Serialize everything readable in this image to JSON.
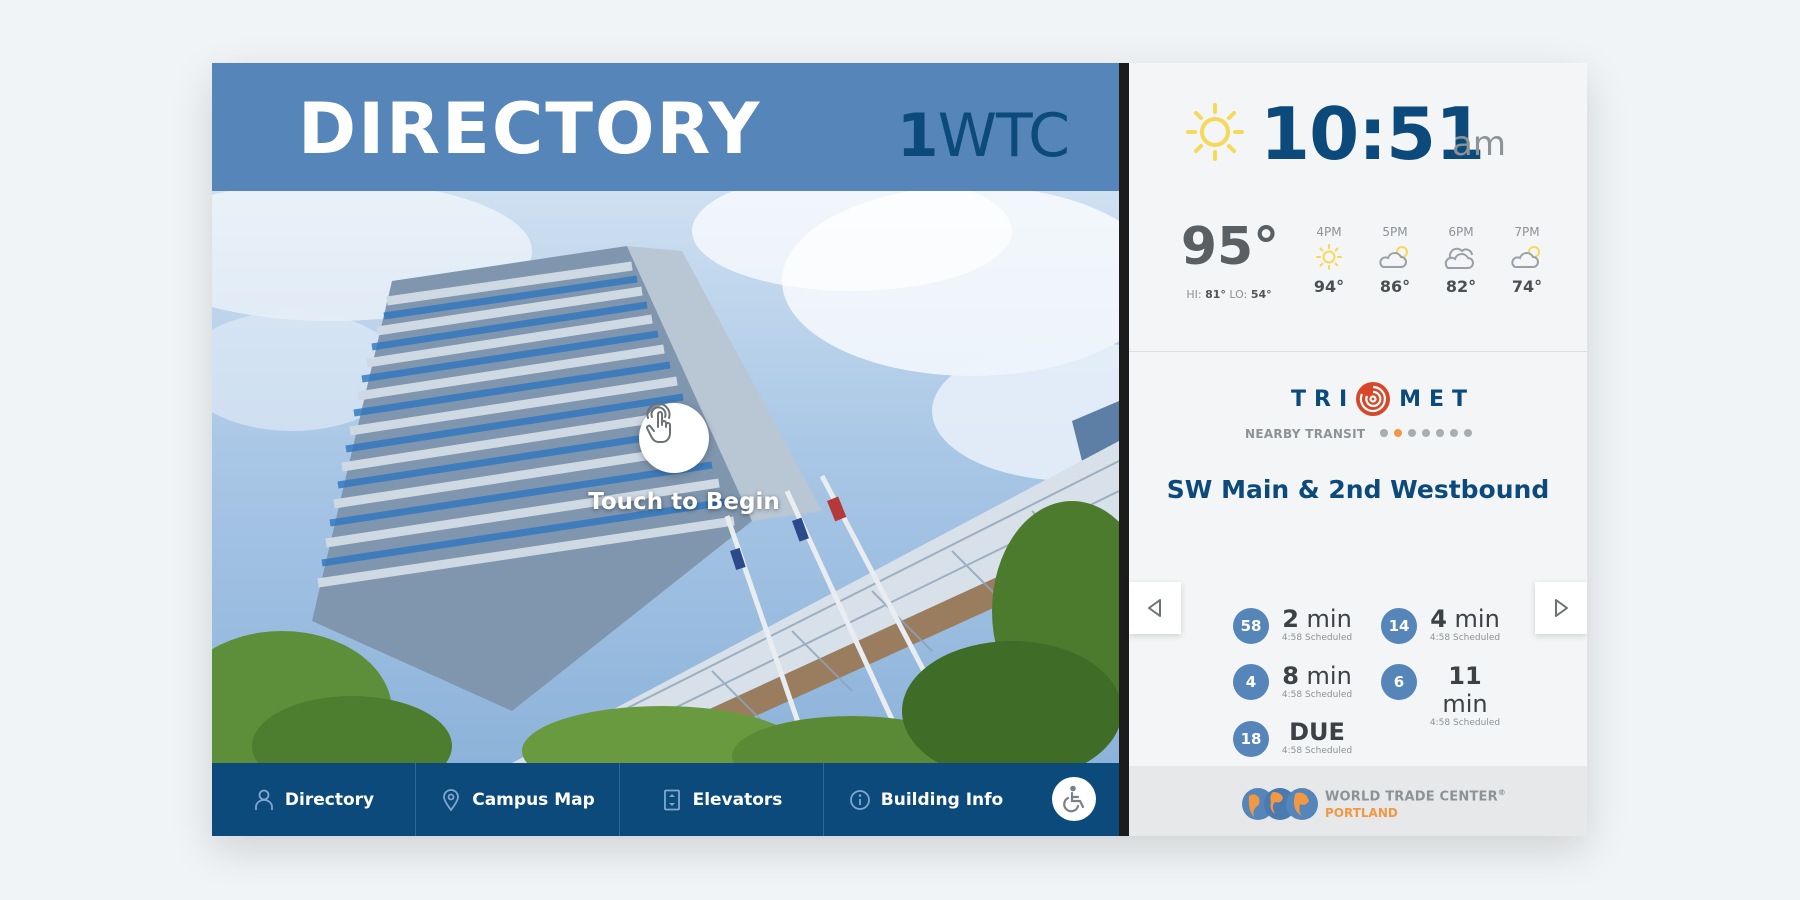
{
  "header": {
    "title": "DIRECTORY",
    "building_num": "1",
    "building_code": "WTC"
  },
  "hero": {
    "touch_label": "Touch to Begin"
  },
  "nav": {
    "items": [
      {
        "label": "Directory",
        "icon": "person-icon"
      },
      {
        "label": "Campus Map",
        "icon": "map-pin-icon"
      },
      {
        "label": "Elevators",
        "icon": "elevator-icon"
      },
      {
        "label": "Building Info",
        "icon": "info-icon"
      }
    ],
    "accessibility_icon": "wheelchair-icon"
  },
  "clock": {
    "time": "10:51",
    "ampm": "am",
    "icon": "sun-icon"
  },
  "weather": {
    "current_temp": "95°",
    "hi_label": "HI:",
    "hi": "81°",
    "lo_label": "LO:",
    "lo": "54°",
    "forecast": [
      {
        "hour": "4PM",
        "icon": "sun-icon",
        "temp": "94°"
      },
      {
        "hour": "5PM",
        "icon": "partly-cloudy-icon",
        "temp": "86°"
      },
      {
        "hour": "6PM",
        "icon": "cloud-icon",
        "temp": "82°"
      },
      {
        "hour": "7PM",
        "icon": "partly-cloudy-icon",
        "temp": "74°"
      }
    ]
  },
  "transit": {
    "brand_left": "TRI",
    "brand_right": "MET",
    "nearby_label": "NEARBY TRANSIT",
    "page_count": 7,
    "active_page": 2,
    "stop_name": "SW Main & 2nd Westbound",
    "arrivals": [
      {
        "route": "58",
        "value": "2",
        "unit": "min",
        "sched": "4:58 Scheduled"
      },
      {
        "route": "14",
        "value": "4",
        "unit": "min",
        "sched": "4:58 Scheduled"
      },
      {
        "route": "4",
        "value": "8",
        "unit": "min",
        "sched": "4:58 Scheduled"
      },
      {
        "route": "6",
        "value": "11",
        "unit": "min",
        "sched": "4:58 Scheduled"
      },
      {
        "route": "18",
        "value": "DUE",
        "unit": "",
        "sched": "4:58 Scheduled"
      }
    ]
  },
  "footer": {
    "name": "WORLD TRADE CENTER",
    "reg": "®",
    "city": "PORTLAND"
  },
  "colors": {
    "primary": "#0b4a7a",
    "header_blue": "#5585b9",
    "accent_orange": "#f29844",
    "sun_yellow": "#f5d95a"
  }
}
